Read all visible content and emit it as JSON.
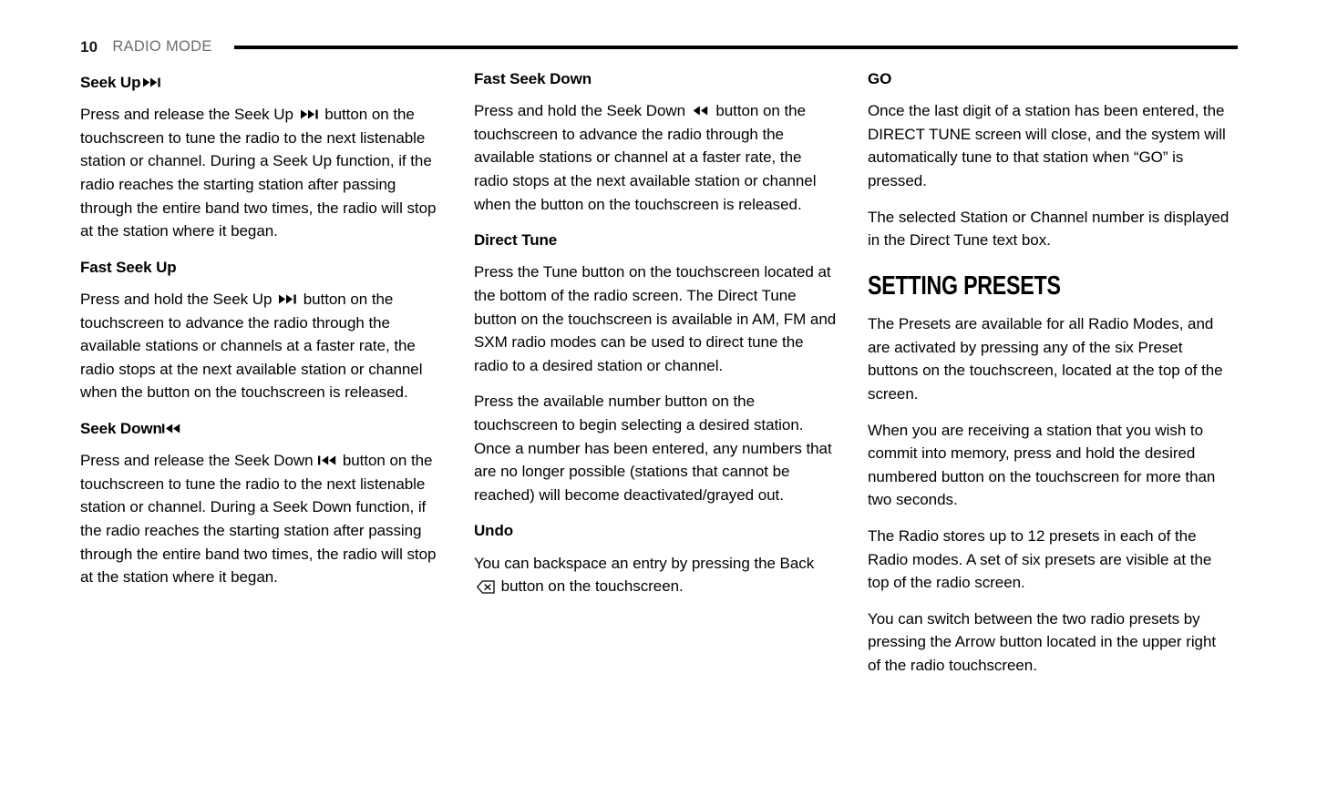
{
  "header": {
    "page_number": "10",
    "title": "RADIO MODE",
    "rule_color": "#000000",
    "title_color": "#6e6e6e"
  },
  "columns": [
    {
      "id": "column-1",
      "blocks": [
        {
          "type": "subheading",
          "name": "heading-seek-up",
          "text": "Seek Up",
          "icon": "next-track-icon"
        },
        {
          "type": "paragraph",
          "name": "paragraph-seek-up",
          "before": "Press and release the Seek Up",
          "icon": "next-track-icon",
          "after": "button on the touchscreen to tune the radio to the next listenable station or channel. During a Seek Up function, if the radio reaches the starting station after passing through the entire band two times, the radio will stop at the station where it began."
        },
        {
          "type": "subheading",
          "name": "heading-fast-seek-up",
          "text": "Fast Seek Up",
          "icon": null
        },
        {
          "type": "paragraph",
          "name": "paragraph-fast-seek-up",
          "before": "Press and hold the Seek Up",
          "icon": "next-track-icon",
          "after": "button on the touchscreen to advance the radio through the available stations or channels at a faster rate, the radio stops at the next available station or channel when the button on the touchscreen is released."
        },
        {
          "type": "subheading",
          "name": "heading-seek-down",
          "text": "Seek Down",
          "icon": "previous-track-icon"
        },
        {
          "type": "paragraph",
          "name": "paragraph-seek-down",
          "before": "Press and release the Seek Down",
          "icon": "previous-track-icon",
          "after": "button on the touchscreen to tune the radio to the next listenable station or channel. During a Seek Down function, if the radio reaches the starting station after passing through the entire band two times, the radio will stop at the station where it began."
        }
      ]
    },
    {
      "id": "column-2",
      "blocks": [
        {
          "type": "subheading",
          "name": "heading-fast-seek-down",
          "text": "Fast Seek Down",
          "icon": null
        },
        {
          "type": "paragraph",
          "name": "paragraph-fast-seek-down",
          "before": "Press and hold the Seek Down",
          "icon": "rewind-icon",
          "after": "button on the touchscreen to advance the radio through the available stations or channel at a faster rate, the radio stops at the next available station or channel when the button on the touchscreen is released."
        },
        {
          "type": "subheading",
          "name": "heading-direct-tune",
          "text": "Direct Tune",
          "icon": null
        },
        {
          "type": "paragraph",
          "name": "paragraph-direct-tune-1",
          "text": "Press the Tune button on the touchscreen located at the bottom of the radio screen. The Direct Tune button on the touchscreen is available in AM, FM and SXM radio modes can be used to direct tune the radio to a desired station or channel."
        },
        {
          "type": "paragraph",
          "name": "paragraph-direct-tune-2",
          "text": "Press the available number button on the touchscreen to begin selecting a desired station. Once a number has been entered, any numbers that are no longer possible (stations that cannot be reached) will become deactivated/grayed out."
        },
        {
          "type": "subheading",
          "name": "heading-undo",
          "text": "Undo",
          "icon": null
        },
        {
          "type": "paragraph",
          "name": "paragraph-undo",
          "before": "You can backspace an entry by pressing the Back",
          "icon": "backspace-icon",
          "after": "button on the touchscreen."
        }
      ]
    },
    {
      "id": "column-3",
      "blocks": [
        {
          "type": "subheading",
          "name": "heading-go",
          "text": "GO",
          "icon": null
        },
        {
          "type": "paragraph",
          "name": "paragraph-go-1",
          "text": "Once the last digit of a station has been entered, the DIRECT TUNE screen will close, and the system will automatically tune to that station when “GO” is pressed."
        },
        {
          "type": "paragraph",
          "name": "paragraph-go-2",
          "text": "The selected Station or Channel number is displayed in the Direct Tune text box."
        },
        {
          "type": "section-heading",
          "name": "heading-setting-presets",
          "text": "SETTING PRESETS"
        },
        {
          "type": "paragraph",
          "name": "paragraph-presets-1",
          "text": "The Presets are available for all Radio Modes, and are activated by pressing any of the six Preset buttons on the touchscreen, located at the top of the screen."
        },
        {
          "type": "paragraph",
          "name": "paragraph-presets-2",
          "text": "When you are receiving a station that you wish to commit into memory, press and hold the desired numbered button on the touchscreen for more than two seconds."
        },
        {
          "type": "paragraph",
          "name": "paragraph-presets-3",
          "text": "The Radio stores up to 12 presets in each of the Radio modes. A set of six presets are visible at the top of the radio screen."
        },
        {
          "type": "paragraph",
          "name": "paragraph-presets-4",
          "text": "You can switch between the two radio presets by pressing the Arrow button located in the upper right of the radio touchscreen."
        }
      ]
    }
  ]
}
